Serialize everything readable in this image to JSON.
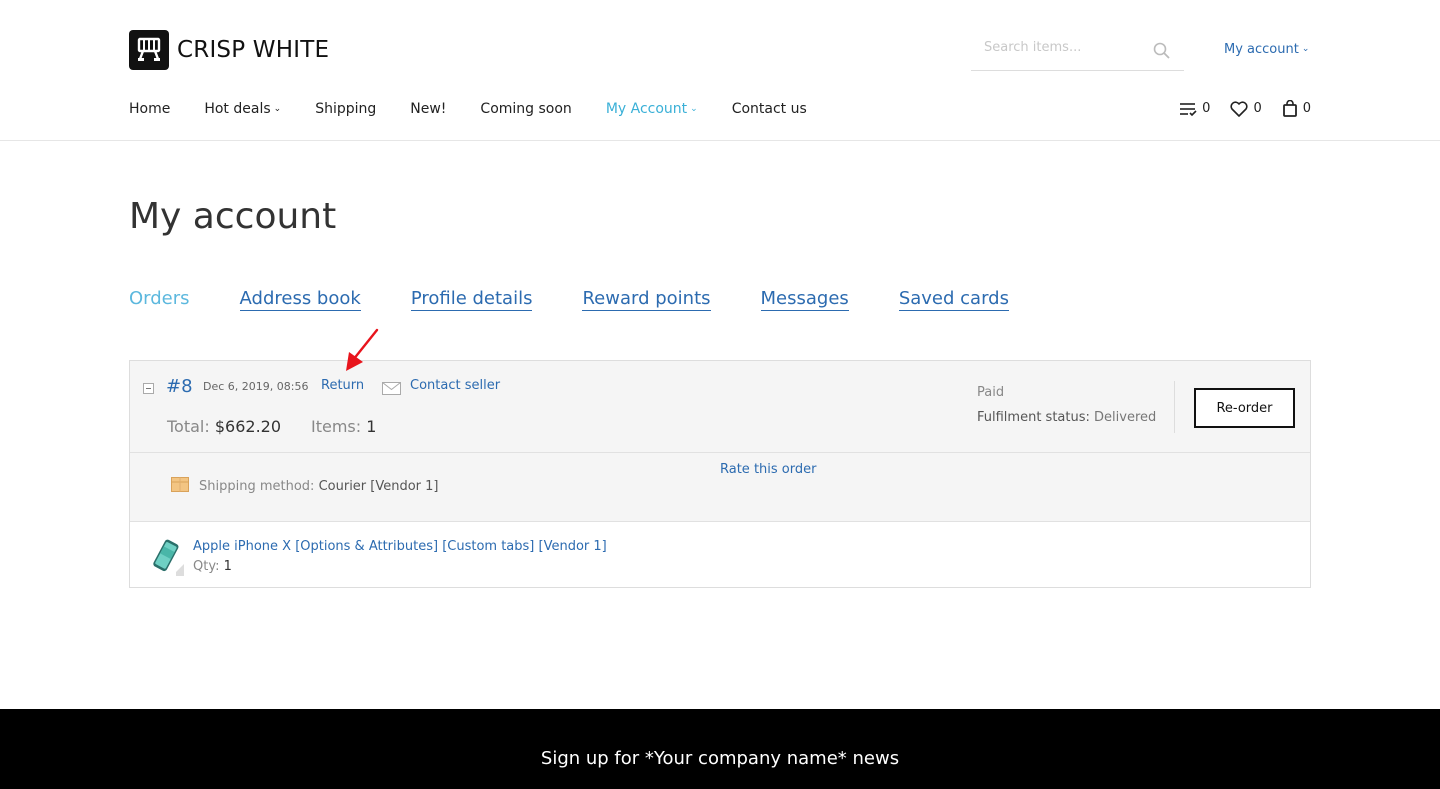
{
  "header": {
    "logo_text": "CRISP WHITE",
    "search_placeholder": "Search items...",
    "account_label": "My account",
    "counters": {
      "compare": "0",
      "wishlist": "0",
      "cart": "0"
    }
  },
  "nav": {
    "home": "Home",
    "hot_deals": "Hot deals",
    "shipping": "Shipping",
    "new": "New!",
    "coming_soon": "Coming soon",
    "my_account": "My Account",
    "contact_us": "Contact us"
  },
  "page": {
    "title": "My account"
  },
  "tabs": {
    "orders": "Orders",
    "address_book": "Address book",
    "profile_details": "Profile details",
    "reward_points": "Reward points",
    "messages": "Messages",
    "saved_cards": "Saved cards"
  },
  "order": {
    "number": "#8",
    "date": "Dec 6, 2019, 08:56",
    "return_label": "Return",
    "contact_seller_label": "Contact seller",
    "total_label": "Total:",
    "total_value": "$662.20",
    "items_label": "Items:",
    "items_value": "1",
    "payment_status": "Paid",
    "fulfilment_label": "Fulfilment status:",
    "fulfilment_value": "Delivered",
    "reorder_label": "Re-order",
    "shipping_label": "Shipping method:",
    "shipping_value": "Courier [Vendor 1]",
    "rate_label": "Rate this order",
    "product": {
      "name": "Apple iPhone X [Options & Attributes] [Custom tabs] [Vendor 1]",
      "qty_label": "Qty:",
      "qty_value": "1"
    }
  },
  "footer": {
    "signup_title": "Sign up for *Your company name* news"
  },
  "colors": {
    "link": "#2c6bb0",
    "active": "#3ab0d7",
    "footer_bg": "#000000",
    "annotation_arrow": "#e8141c"
  }
}
